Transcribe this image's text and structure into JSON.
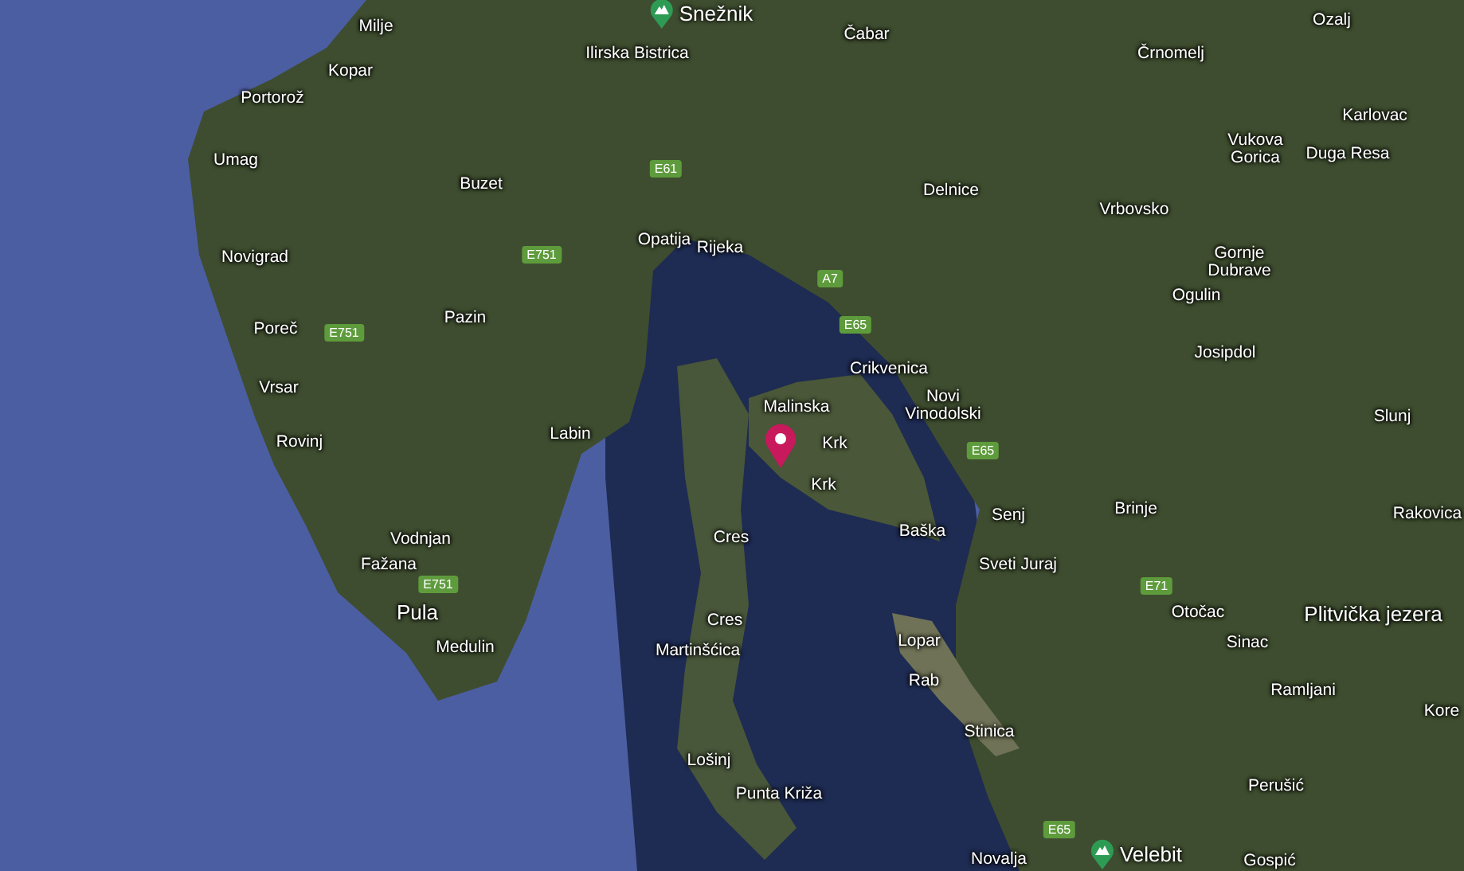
{
  "map": {
    "labels": [
      {
        "kind": "peak",
        "text": "Snežnik"
      },
      {
        "kind": "place",
        "text": "Milje"
      },
      {
        "kind": "place",
        "text": "Čabar"
      },
      {
        "kind": "place",
        "text": "Ozalj"
      },
      {
        "kind": "place",
        "text": "Ilirska Bistrica"
      },
      {
        "kind": "place",
        "text": "Črnomelj"
      },
      {
        "kind": "place",
        "text": "Kopar"
      },
      {
        "kind": "place",
        "text": "Portorož"
      },
      {
        "kind": "place",
        "text": "Karlovac"
      },
      {
        "kind": "place",
        "text": "Umag"
      },
      {
        "kind": "place",
        "text": "Vukova Gorica"
      },
      {
        "kind": "place",
        "text": "Duga Resa"
      },
      {
        "kind": "road",
        "text": "E61"
      },
      {
        "kind": "place",
        "text": "Buzet"
      },
      {
        "kind": "place",
        "text": "Delnice"
      },
      {
        "kind": "place",
        "text": "Vrbovsko"
      },
      {
        "kind": "road",
        "text": "E751"
      },
      {
        "kind": "place",
        "text": "Opatija"
      },
      {
        "kind": "place",
        "text": "Rijeka"
      },
      {
        "kind": "place",
        "text": "Novigrad"
      },
      {
        "kind": "place",
        "text": "Gornje Dubrave"
      },
      {
        "kind": "road",
        "text": "A7"
      },
      {
        "kind": "place",
        "text": "Ogulin"
      },
      {
        "kind": "place",
        "text": "Pazin"
      },
      {
        "kind": "road",
        "text": "E65"
      },
      {
        "kind": "place",
        "text": "Poreč"
      },
      {
        "kind": "road",
        "text": "E751"
      },
      {
        "kind": "place",
        "text": "Josipdol"
      },
      {
        "kind": "place",
        "text": "Crikvenica"
      },
      {
        "kind": "place",
        "text": "Vrsar"
      },
      {
        "kind": "place",
        "text": "Malinska"
      },
      {
        "kind": "place",
        "text": "Novi Vinodolski"
      },
      {
        "kind": "place",
        "text": "Slunj"
      },
      {
        "kind": "place",
        "text": "Rovinj"
      },
      {
        "kind": "place",
        "text": "Labin"
      },
      {
        "kind": "place",
        "text": "Krk"
      },
      {
        "kind": "road",
        "text": "E65"
      },
      {
        "kind": "place",
        "text": "Krk"
      },
      {
        "kind": "place",
        "text": "Vodnjan"
      },
      {
        "kind": "place",
        "text": "Cres"
      },
      {
        "kind": "place",
        "text": "Baška"
      },
      {
        "kind": "place",
        "text": "Senj"
      },
      {
        "kind": "place",
        "text": "Brinje"
      },
      {
        "kind": "place",
        "text": "Rakovica"
      },
      {
        "kind": "place",
        "text": "Fažana"
      },
      {
        "kind": "place",
        "text": "Sveti Juraj"
      },
      {
        "kind": "road",
        "text": "E751"
      },
      {
        "kind": "road",
        "text": "E71"
      },
      {
        "kind": "place",
        "text": "Pula"
      },
      {
        "kind": "place",
        "text": "Cres"
      },
      {
        "kind": "place",
        "text": "Otočac"
      },
      {
        "kind": "place",
        "text": "Plitvička jezera"
      },
      {
        "kind": "place",
        "text": "Medulin"
      },
      {
        "kind": "place",
        "text": "Martinšćica"
      },
      {
        "kind": "place",
        "text": "Lopar"
      },
      {
        "kind": "place",
        "text": "Sinac"
      },
      {
        "kind": "place",
        "text": "Rab"
      },
      {
        "kind": "place",
        "text": "Ramljani"
      },
      {
        "kind": "place",
        "text": "Kore"
      },
      {
        "kind": "place",
        "text": "Stinica"
      },
      {
        "kind": "place",
        "text": "Lošinj"
      },
      {
        "kind": "place",
        "text": "Punta Križa"
      },
      {
        "kind": "place",
        "text": "Perušić"
      },
      {
        "kind": "road",
        "text": "E65"
      },
      {
        "kind": "place",
        "text": "Novalja"
      },
      {
        "kind": "peak",
        "text": "Velebit"
      },
      {
        "kind": "place",
        "text": "Gospić"
      }
    ]
  }
}
